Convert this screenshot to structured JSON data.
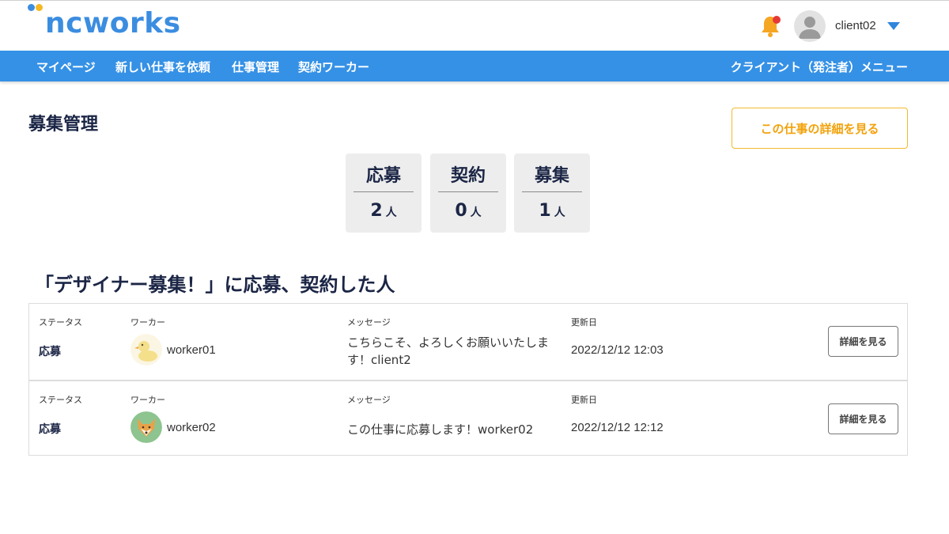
{
  "header": {
    "logo_text": "ncworks",
    "username": "client02",
    "colors": {
      "brand_blue": "#3b8de0",
      "brand_yellow": "#f5b821",
      "notification_dot": "#e53935"
    }
  },
  "nav": {
    "items": [
      "マイページ",
      "新しい仕事を依頼",
      "仕事管理",
      "契約ワーカー"
    ],
    "right_label": "クライアント（発注者）メニュー"
  },
  "page": {
    "title": "募集管理",
    "detail_button": "この仕事の詳細を見る"
  },
  "stats": [
    {
      "label": "応募",
      "value": "2",
      "unit": "人"
    },
    {
      "label": "契約",
      "value": "0",
      "unit": "人"
    },
    {
      "label": "募集",
      "value": "1",
      "unit": "人"
    }
  ],
  "section_title": "「デザイナー募集！」に応募、契約した人",
  "table": {
    "headers": {
      "status": "ステータス",
      "worker": "ワーカー",
      "message": "メッセージ",
      "date": "更新日"
    },
    "rows": [
      {
        "status": "応募",
        "worker": "worker01",
        "avatar_icon": "duck-icon",
        "message": "こちらこそ、よろしくお願いいたします！client2",
        "date": "2022/12/12 12:03",
        "button": "詳細を見る"
      },
      {
        "status": "応募",
        "worker": "worker02",
        "avatar_icon": "fox-icon",
        "message": "この仕事に応募します！worker02",
        "date": "2022/12/12 12:12",
        "button": "詳細を見る"
      }
    ]
  }
}
